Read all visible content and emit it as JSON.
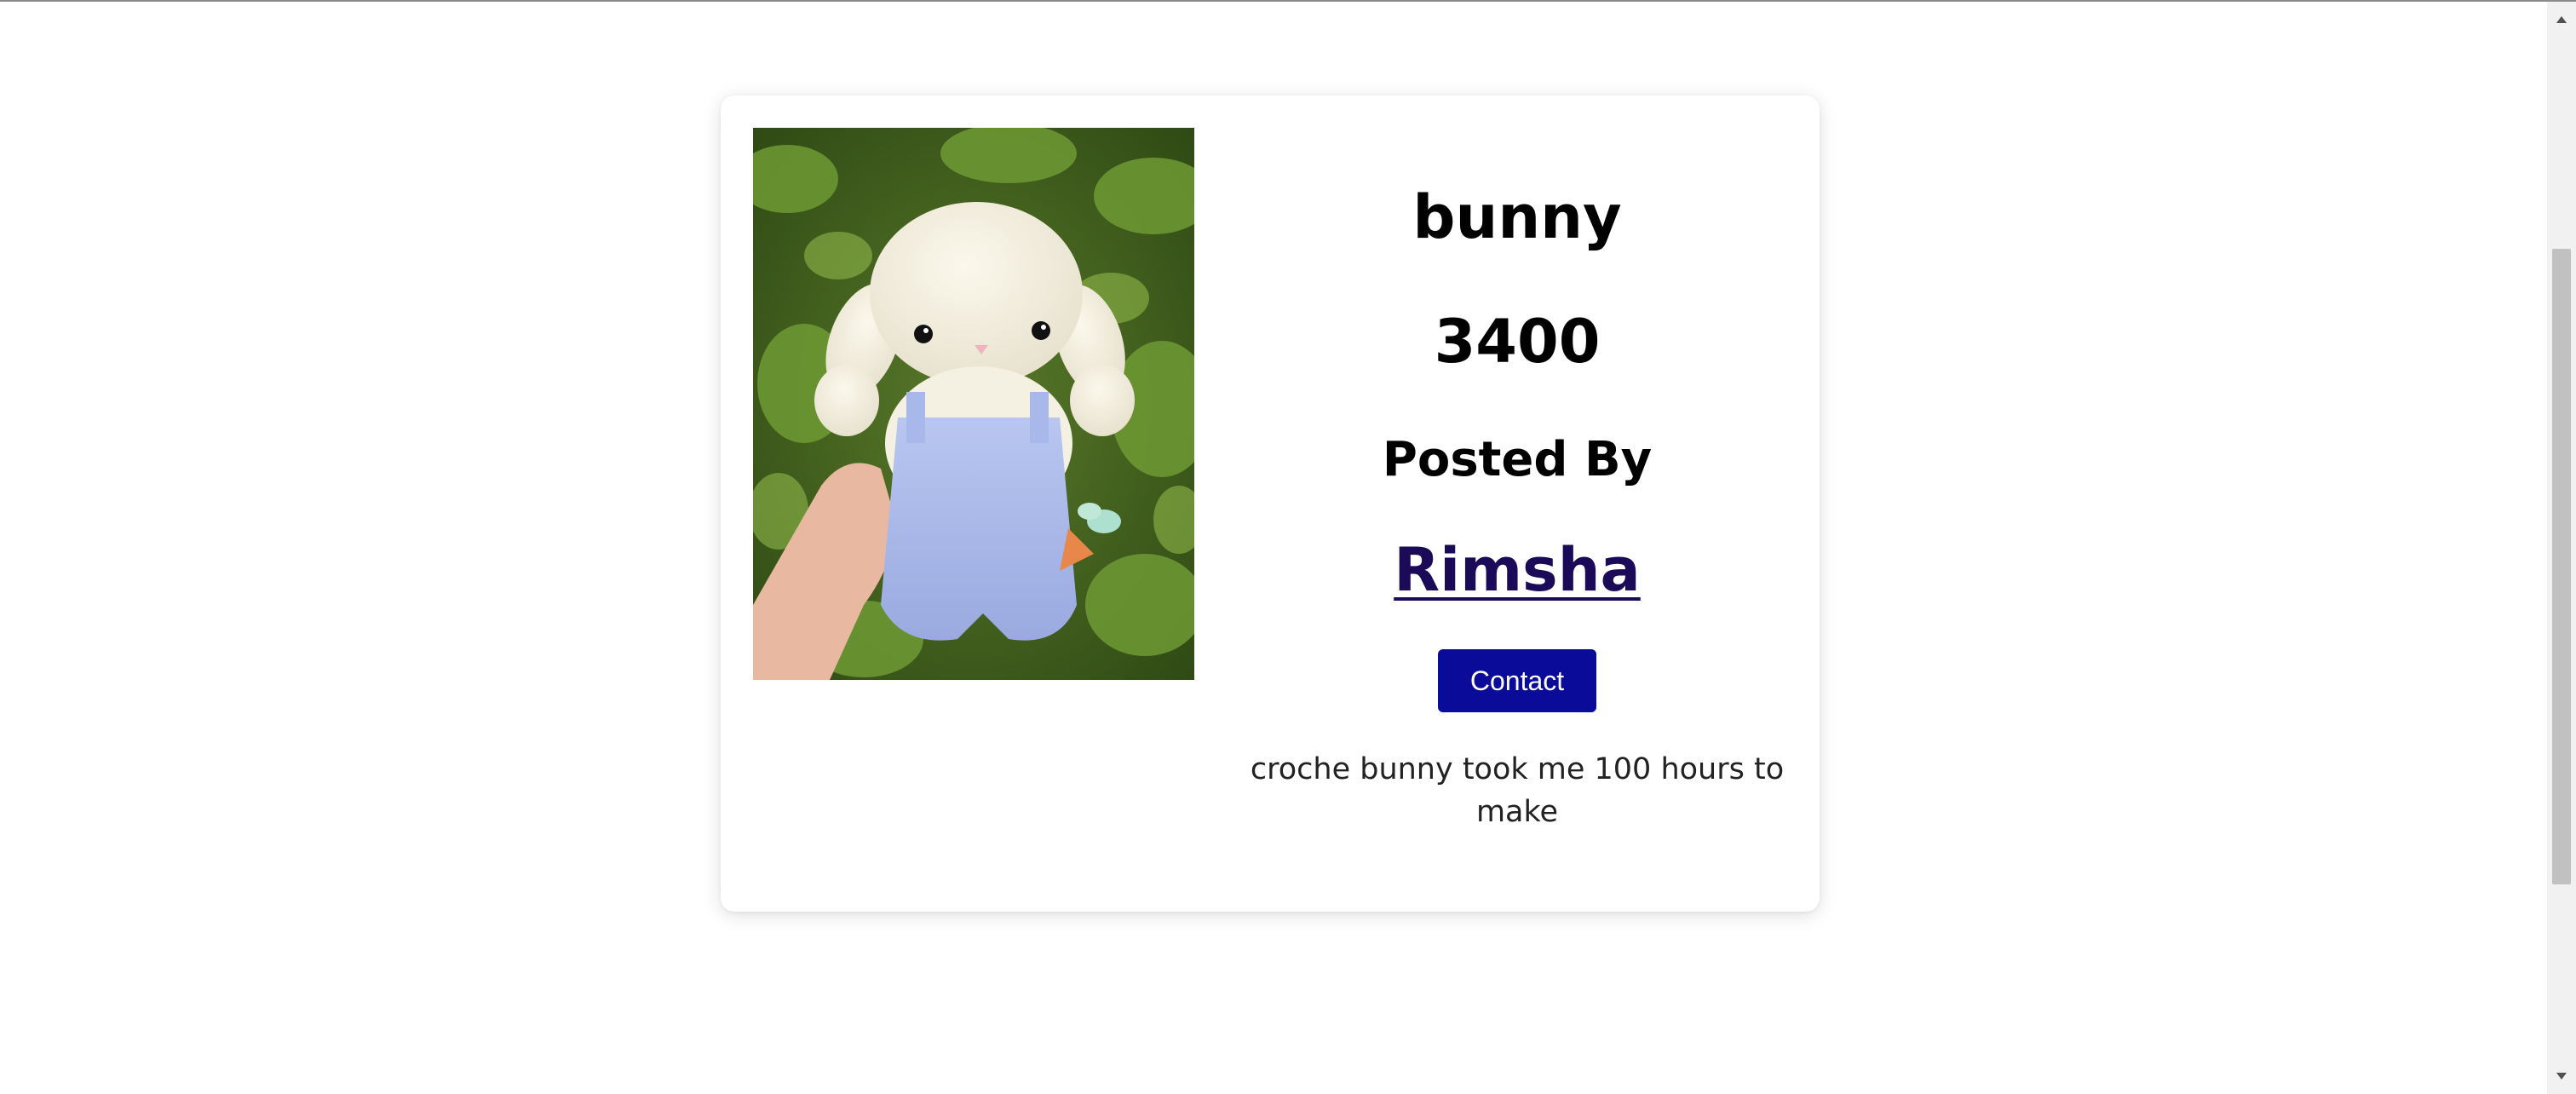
{
  "listing": {
    "title": "bunny",
    "price": "3400",
    "posted_by_label": "Posted By",
    "author": "Rimsha",
    "contact_label": "Contact",
    "description": "croche bunny took me 100 hours to make",
    "image_icon": "crochet-bunny-photo"
  },
  "colors": {
    "contact_button_bg": "#0b0b99",
    "author_link": "#1a0a58",
    "scrollbar_track": "#f1f1f1",
    "scrollbar_thumb": "#c1c1c1"
  },
  "scrollbar": {
    "up_icon": "arrow-up-icon",
    "down_icon": "arrow-down-icon"
  }
}
